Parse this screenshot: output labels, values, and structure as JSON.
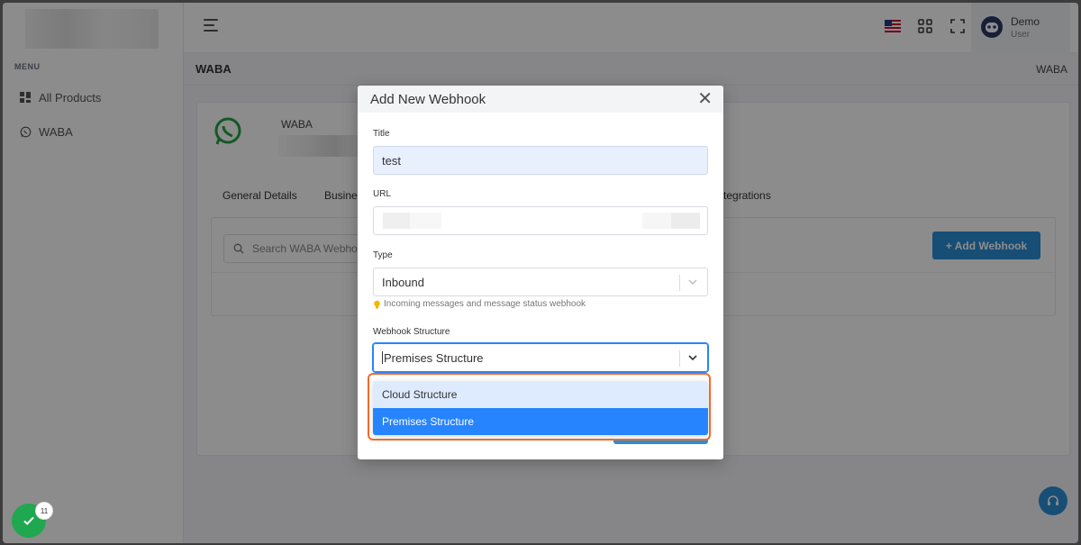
{
  "sidebar": {
    "menu_title": "MENU",
    "items": [
      {
        "label": "All Products",
        "icon": "grid-icon"
      },
      {
        "label": "WABA",
        "icon": "whatsapp-icon"
      }
    ]
  },
  "header": {
    "user_name": "Demo",
    "user_role": "User"
  },
  "page": {
    "title": "WABA",
    "breadcrumb": "WABA"
  },
  "waba_card": {
    "label": "WABA",
    "tabs": [
      "General Details",
      "Busine",
      "Integrations"
    ],
    "search_placeholder": "Search WABA Webho",
    "add_button": "+ Add Webhook"
  },
  "modal": {
    "title": "Add New Webhook",
    "title_label": "Title",
    "title_value": "test",
    "url_label": "URL",
    "type_label": "Type",
    "type_value": "Inbound",
    "type_hint": "Incoming messages and message status webhook",
    "structure_label": "Webhook Structure",
    "structure_value": "Premises Structure",
    "options": [
      "Cloud Structure",
      "Premises Structure"
    ]
  },
  "badge": {
    "count": "11"
  },
  "colors": {
    "accent": "#2a8fd6",
    "select_blue": "#2684ff",
    "highlight": "#f26a2b",
    "whatsapp": "#25a244"
  }
}
